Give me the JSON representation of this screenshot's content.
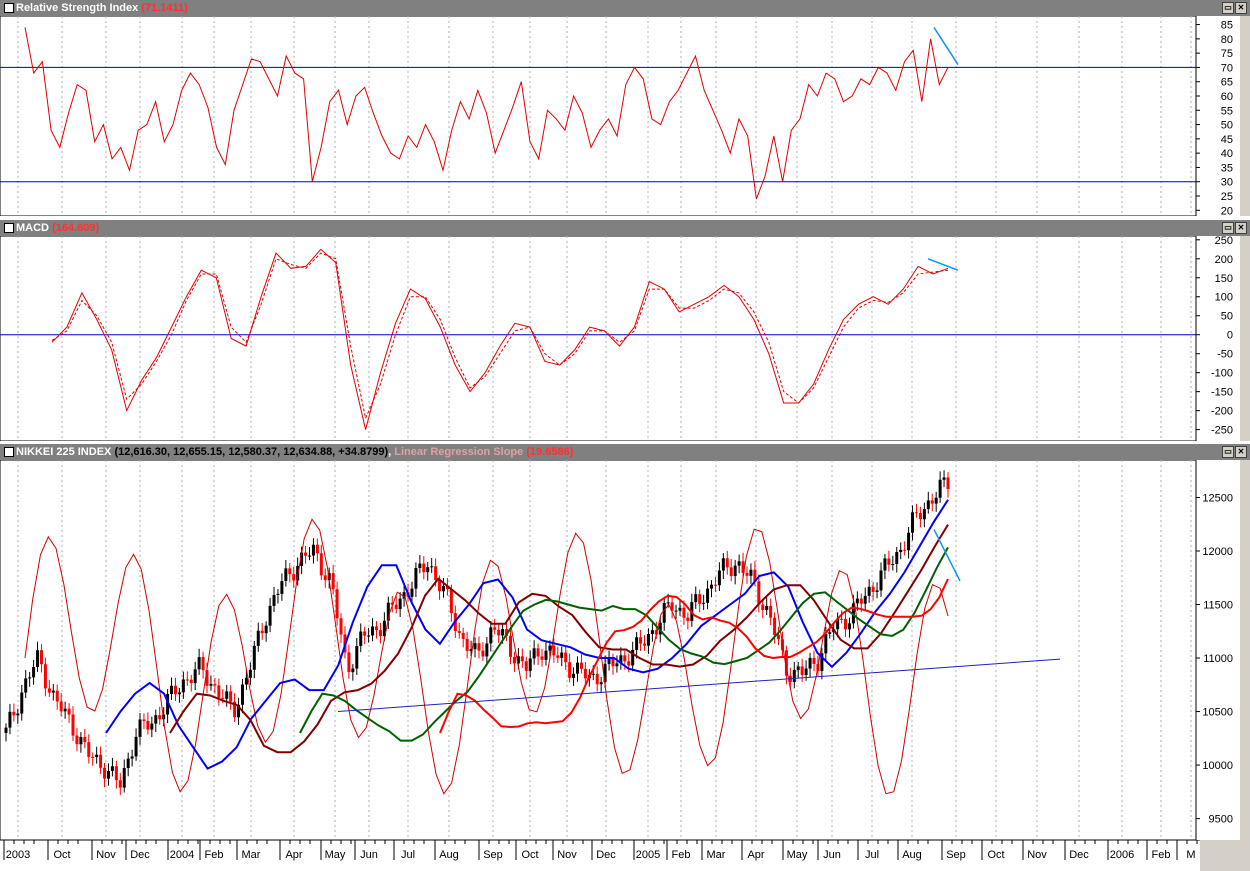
{
  "panels": {
    "rsi": {
      "title": "Relative Strength Index",
      "value": "(71.1411)",
      "yticks": [
        "85",
        "80",
        "75",
        "70",
        "65",
        "60",
        "55",
        "50",
        "45",
        "40",
        "35",
        "30",
        "25",
        "20"
      ]
    },
    "macd": {
      "title": "MACD",
      "value": "(164.609)",
      "yticks": [
        "250",
        "200",
        "150",
        "100",
        "50",
        "0",
        "-50",
        "-100",
        "-150",
        "-200",
        "-250"
      ]
    },
    "nikkei": {
      "title": "NIKKEI 225 INDEX",
      "ohlc": "(12,616.30, 12,655.15, 12,580.37, 12,634.88, +34.8799)",
      "indicator": "Linear Regression Slope",
      "indicator_value": "(19.6586)",
      "yticks": [
        "12500",
        "12000",
        "11500",
        "11000",
        "10500",
        "10000",
        "9500"
      ]
    }
  },
  "window_buttons": [
    "▭",
    "✕"
  ],
  "x_axis": {
    "labels": [
      "2003",
      "Oct",
      "Nov",
      "Dec",
      "2004",
      "Feb",
      "Mar",
      "Apr",
      "May",
      "Jun",
      "Jul",
      "Aug",
      "Sep",
      "Oct",
      "Nov",
      "Dec",
      "2005",
      "Feb",
      "Mar",
      "Apr",
      "May",
      "Jun",
      "Jul",
      "Aug",
      "Sep",
      "Oct",
      "Nov",
      "Dec",
      "2006",
      "Feb",
      "M"
    ]
  },
  "colors": {
    "price_up": "#000000",
    "price_down": "#ff0000",
    "rsi_line": "#e00000",
    "macd_line": "#e00000",
    "signal_line": "#e00000",
    "ref_line": "#0000c0",
    "ma_blue": "#0000ff",
    "ma_darkred": "#800000",
    "ma_green": "#006000",
    "ma_red": "#ff0000",
    "trendline": "#2020c0",
    "annotation": "#1090ff"
  },
  "chart_data": [
    {
      "type": "line",
      "title": "Relative Strength Index",
      "ylim": [
        18,
        88
      ],
      "reference_lines": [
        70,
        30
      ],
      "series": [
        {
          "values": [
            84,
            68,
            72,
            48,
            42,
            54,
            64,
            62,
            44,
            50,
            38,
            42,
            34,
            48,
            50,
            58,
            44,
            50,
            62,
            68,
            64,
            56,
            42,
            36,
            55,
            64,
            73,
            72,
            66,
            60,
            74,
            68,
            66,
            30,
            42,
            58,
            62,
            50,
            60,
            63,
            54,
            46,
            40,
            38,
            46,
            42,
            50,
            44,
            34,
            48,
            58,
            52,
            62,
            54,
            40,
            48,
            56,
            65,
            44,
            38,
            55,
            52,
            48,
            60,
            54,
            42,
            48,
            52,
            46,
            64,
            70,
            66,
            52,
            50,
            58,
            62,
            68,
            74,
            62,
            55,
            48,
            40,
            52,
            46,
            24,
            32,
            46,
            30,
            48,
            52,
            64,
            60,
            68,
            66,
            58,
            60,
            66,
            64,
            70,
            68,
            62,
            72,
            76,
            58,
            80,
            64,
            70
          ]
        }
      ]
    },
    {
      "type": "line",
      "title": "MACD",
      "ylim": [
        -280,
        260
      ],
      "reference_lines": [
        0
      ],
      "series": [
        {
          "values": [
            -20,
            20,
            110,
            40,
            -40,
            -200,
            -120,
            -60,
            20,
            100,
            170,
            150,
            -10,
            -30,
            100,
            215,
            175,
            180,
            225,
            190,
            -80,
            -250,
            -100,
            30,
            120,
            95,
            20,
            -80,
            -150,
            -100,
            -30,
            30,
            20,
            -70,
            -80,
            -40,
            20,
            10,
            -30,
            20,
            140,
            120,
            60,
            80,
            100,
            130,
            100,
            40,
            -50,
            -180,
            -180,
            -130,
            -40,
            40,
            80,
            100,
            80,
            120,
            180,
            160,
            175
          ]
        },
        {
          "values": [
            -15,
            10,
            90,
            50,
            -20,
            -170,
            -130,
            -70,
            0,
            90,
            160,
            160,
            20,
            -20,
            80,
            200,
            185,
            175,
            215,
            200,
            -30,
            -220,
            -130,
            0,
            100,
            100,
            40,
            -60,
            -140,
            -110,
            -50,
            10,
            20,
            -50,
            -80,
            -50,
            10,
            10,
            -20,
            10,
            120,
            120,
            70,
            70,
            90,
            120,
            110,
            60,
            -20,
            -150,
            -180,
            -140,
            -60,
            20,
            70,
            90,
            85,
            110,
            160,
            165,
            170
          ]
        }
      ]
    },
    {
      "type": "candlestick",
      "title": "NIKKEI 225 INDEX",
      "ylim": [
        9300,
        12850
      ],
      "series": [
        {
          "name": "close",
          "values": [
            10300,
            10700,
            11000,
            10600,
            10400,
            10100,
            10000,
            9800,
            10300,
            10400,
            10600,
            10800,
            10900,
            10700,
            10500,
            10900,
            11400,
            11700,
            11900,
            12000,
            11700,
            10900,
            11200,
            11300,
            11500,
            11700,
            11900,
            11600,
            11200,
            11000,
            11300,
            11100,
            10900,
            11100,
            11000,
            10900,
            10800,
            10900,
            11000,
            11100,
            11300,
            11500,
            11400,
            11600,
            11800,
            11900,
            11700,
            11400,
            10900,
            10850,
            11000,
            11300,
            11400,
            11600,
            11800,
            12000,
            12300,
            12500,
            12634
          ]
        }
      ]
    }
  ]
}
